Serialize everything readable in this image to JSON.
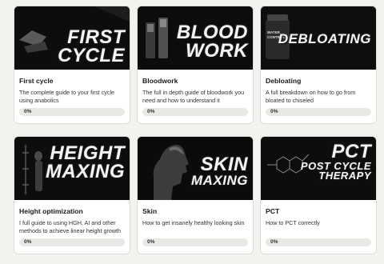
{
  "courses": [
    {
      "banner_lines": [
        "FIRST",
        "CYCLE"
      ],
      "title": "First cycle",
      "description": "The complete guide to your first cycle using anabolics",
      "progress": 0,
      "progress_label": "0%"
    },
    {
      "banner_lines": [
        "BLOOD",
        "WORK"
      ],
      "title": "Bloodwork",
      "description": "The full in depth guide of bloodwork you need and how to understand it",
      "progress": 0,
      "progress_label": "0%"
    },
    {
      "banner_lines": [
        "DEBLOATING"
      ],
      "banner_small": "WATER CONTROL",
      "title": "Debloating",
      "description": "A full breakdown on how to go from bloated to chiseled",
      "progress": 0,
      "progress_label": "0%"
    },
    {
      "banner_lines": [
        "HEIGHT",
        "MAXING"
      ],
      "title": "Height optimization",
      "description": "I full guide to using HGH, AI and other methods to achieve linear height growth",
      "progress": 0,
      "progress_label": "0%"
    },
    {
      "banner_lines": [
        "SKIN",
        "MAXING"
      ],
      "title": "Skin",
      "description": "How to get insanely healthy looking skin",
      "progress": 0,
      "progress_label": "0%"
    },
    {
      "banner_lines": [
        "PCT",
        "POST CYCLE",
        "THERAPY"
      ],
      "title": "PCT",
      "description": "How to PCT correctly",
      "progress": 0,
      "progress_label": "0%"
    }
  ],
  "colors": {
    "page_bg": "#f3f2ef",
    "thumb_bg": "#0b0b0b",
    "track": "#e9e8e5"
  }
}
